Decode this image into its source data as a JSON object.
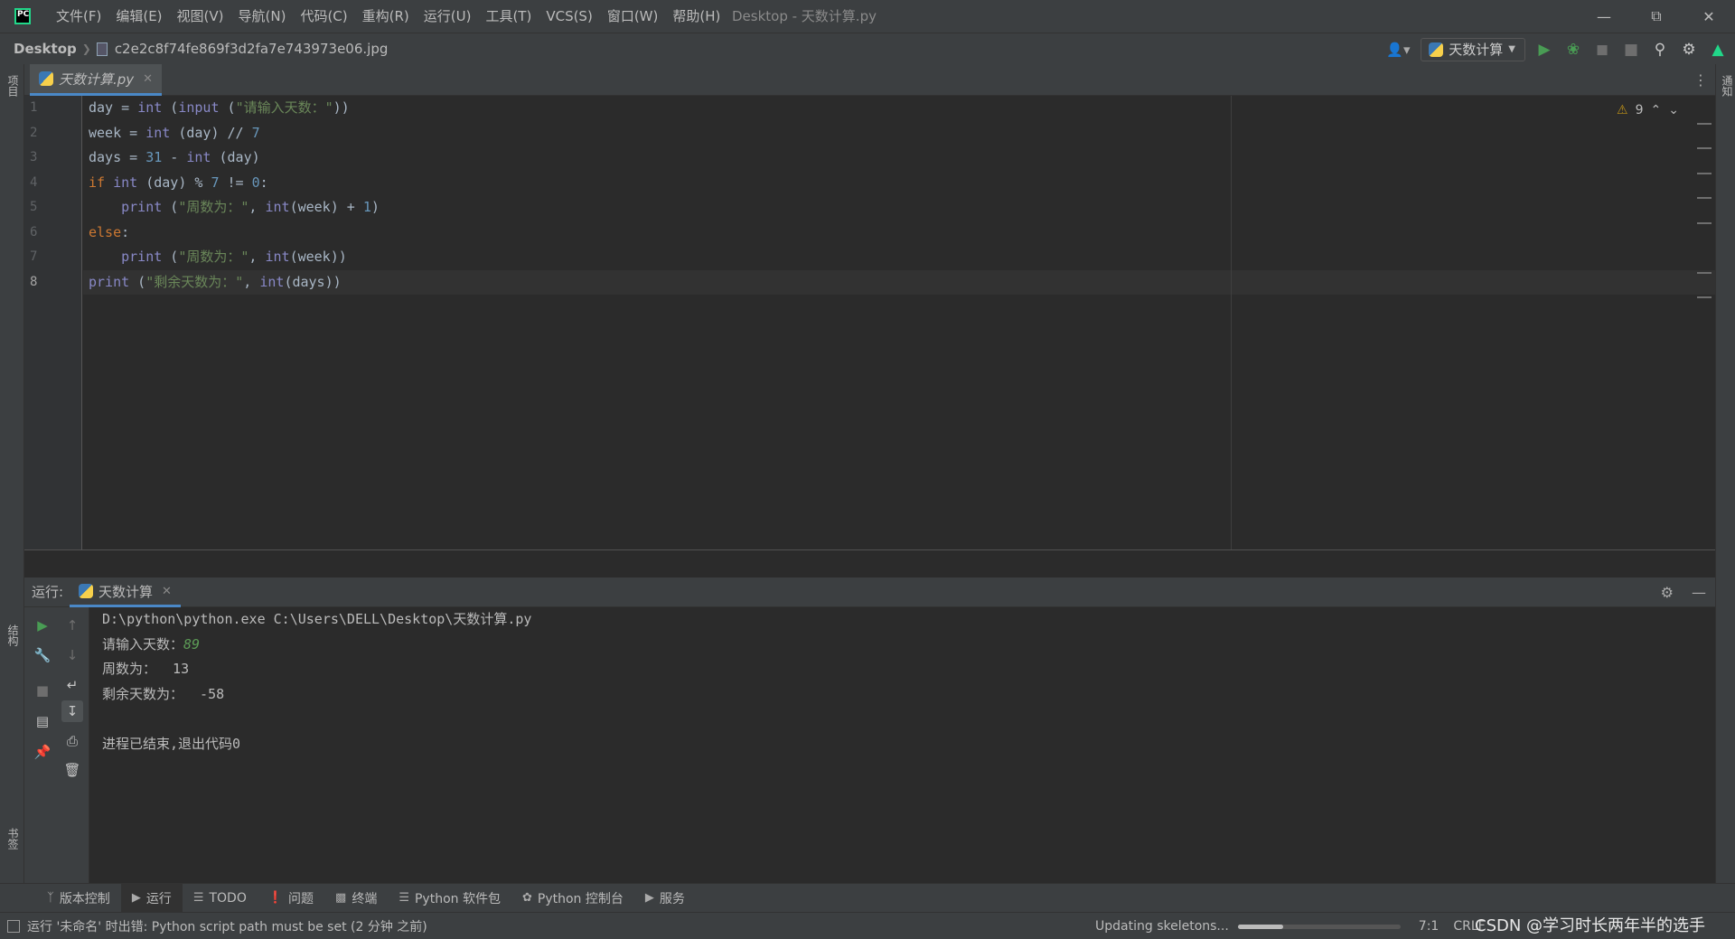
{
  "titlebar": {
    "menu": [
      "文件(F)",
      "编辑(E)",
      "视图(V)",
      "导航(N)",
      "代码(C)",
      "重构(R)",
      "运行(U)",
      "工具(T)",
      "VCS(S)",
      "窗口(W)",
      "帮助(H)"
    ],
    "window_title": "Desktop - 天数计算.py"
  },
  "navbar": {
    "root": "Desktop",
    "file": "c2e2c8f74fe869f3d2fa7e743973e06.jpg",
    "run_config": "天数计算"
  },
  "left_strip": {
    "top_label": "项目",
    "mid_label": "结构",
    "bottom_label": "书签"
  },
  "right_strip": {
    "label": "通知"
  },
  "editor": {
    "tab_label": "天数计算.py",
    "warnings": "9",
    "current_line": 8,
    "line_numbers": [
      "1",
      "2",
      "3",
      "4",
      "5",
      "6",
      "7",
      "8"
    ],
    "lines": [
      "day = int (input (\"请输入天数：\"))",
      "week = int (day) // 7",
      "days = 31 - int (day)",
      "if int (day) % 7 != 0:",
      "    print (\"周数为：\", int(week) + 1)",
      "else:",
      "    print (\"周数为：\", int(week))",
      "print (\"剩余天数为：\", int(days))"
    ]
  },
  "run_panel": {
    "title": "运行:",
    "tab_label": "天数计算",
    "console": {
      "command": "D:\\python\\python.exe C:\\Users\\DELL\\Desktop\\天数计算.py",
      "prompt": "请输入天数：",
      "input_value": "89",
      "line_week": "周数为：  13",
      "line_days": "剩余天数为：  -58",
      "exit_msg": "进程已结束,退出代码0"
    }
  },
  "toolwindows": [
    "版本控制",
    "运行",
    "TODO",
    "问题",
    "终端",
    "Python 软件包",
    "Python 控制台",
    "服务"
  ],
  "statusbar": {
    "message": "运行 '未命名' 时出错: Python script path must be set (2 分钟 之前)",
    "progress_label": "Updating skeletons...",
    "progress_fraction": 0.28,
    "position": "7:1",
    "encoding": "CRLF",
    "watermark": "CSDN @学习时长两年半的选手"
  },
  "colors": {
    "keyword": "#cc7832",
    "builtin": "#8888c6",
    "string": "#6a8759",
    "number": "#6897bb",
    "accent": "#4a88c7",
    "run_green": "#499c54"
  }
}
